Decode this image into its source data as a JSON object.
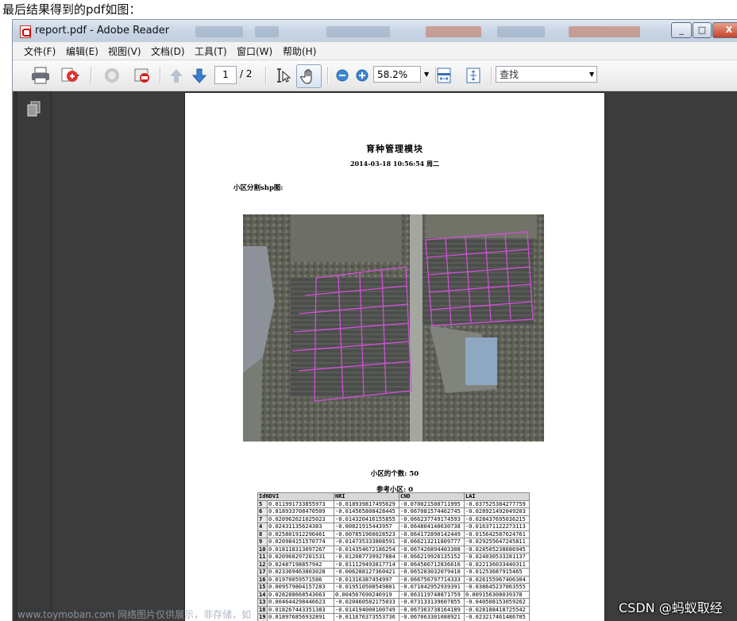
{
  "caption": "最后结果得到的pdf如图：",
  "window": {
    "title": "report.pdf - Adobe Reader",
    "controls": {
      "minimize": "_",
      "maximize": "□",
      "close": "X"
    }
  },
  "menu": [
    "文件(F)",
    "编辑(E)",
    "视图(V)",
    "文档(D)",
    "工具(T)",
    "窗口(W)",
    "帮助(H)"
  ],
  "toolbar": {
    "current_page": "1",
    "total_pages": "/ 2",
    "zoom": "58.2%",
    "find_placeholder": "查找",
    "icons": [
      "print-icon",
      "create-pdf-icon",
      "collaborate-icon",
      "secure-icon",
      "previous-page-icon",
      "next-page-icon",
      "select-text-icon",
      "hand-tool-icon",
      "zoom-out-icon",
      "zoom-in-icon",
      "fit-width-icon",
      "fit-page-icon"
    ]
  },
  "document": {
    "title": "育种管理模块",
    "datetime": "2014-03-18 10:56:54 周二",
    "section_label": "小区分割shp图:",
    "plot_count_label": "小区的个数: 50",
    "ref_plot_label": "参考小区: 0",
    "table": {
      "headers": [
        "Id",
        "NDVI",
        "NRI",
        "CND",
        "LAI"
      ],
      "rows": [
        [
          "5",
          "0.011991733855973",
          "-0.018939817495629",
          "-0.070021500711995",
          "-0.037525384277759"
        ],
        [
          "6",
          "0.018933708470509",
          "-0.014565808428445",
          "-0.067081574462745",
          "-0.028921492049203"
        ],
        [
          "7",
          "0.020962621025023",
          "-0.014320416155855",
          "-0.066237749174593",
          "-0.028437695036215"
        ],
        [
          "4",
          "0.02431135624383",
          "-0.00821915443957",
          "-0.064804140630738",
          "-0.016371122273113"
        ],
        [
          "8",
          "0.025801912296461",
          "-0.007851960028523",
          "-0.064172890142449",
          "-0.015642587624761"
        ],
        [
          "9",
          "0.020984151570774",
          "-0.014735333808591",
          "-0.066213211809777",
          "-0.029255647245811"
        ],
        [
          "10",
          "0.018118313097267",
          "-0.014354672186254",
          "-0.067426894403308",
          "-0.028505238686945"
        ],
        [
          "11",
          "0.020968297201531",
          "-0.012087739927884",
          "-0.066219926135152",
          "-0.024030533281137"
        ],
        [
          "12",
          "0.02487198857942",
          "-0.011129493817714",
          "-0.064566712836616",
          "-0.022136033440311"
        ],
        [
          "17",
          "0.023369463803028",
          "-0.006288127360421",
          "-0.065203032079418",
          "-0.01253687915465"
        ],
        [
          "16",
          "0.01970059571586",
          "-0.01316387454997",
          "-0.066756797714333",
          "-0.026155967406304"
        ],
        [
          "15",
          "0.009579804157283",
          "-0.019510508549801",
          "-0.071042952939391",
          "-0.038645237063555"
        ],
        [
          "14",
          "0.028288668543663",
          "0.004567690246919",
          "-0.063119748871759",
          "0.009156308039378"
        ],
        [
          "13",
          "0.004644298446623",
          "-0.020460582175033",
          "-0.073133139607855",
          "-0.040508153059262"
        ],
        [
          "18",
          "0.018267443351383",
          "-0.014194000100749",
          "-0.067363738164189",
          "-0.028188418725542"
        ],
        [
          "19",
          "0.018976856932891",
          "-0.011676373553736",
          "-0.067063301088921",
          "-0.023217461486705"
        ]
      ]
    }
  },
  "watermarks": {
    "csdn": "CSDN @蚂蚁取经",
    "site": "www.toymoban.com 网络图片仅供展示，非存储，如"
  }
}
